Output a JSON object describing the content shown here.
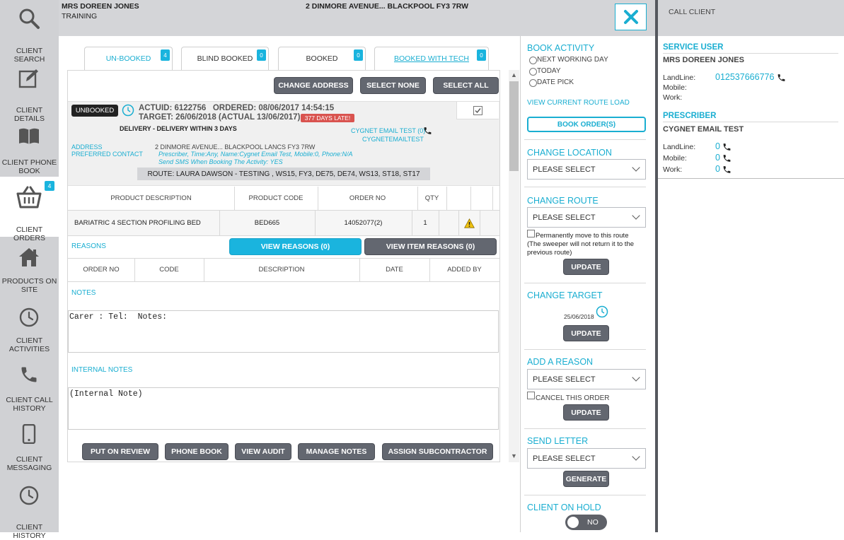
{
  "header": {
    "client_name": "MRS DOREEN JONES",
    "client_sub": "TRAINING",
    "address": "2 DINMORE AVENUE... BLACKPOOL FY3 7RW",
    "call_client": "CALL CLIENT"
  },
  "sidebar": {
    "items": [
      {
        "label": "CLIENT SEARCH"
      },
      {
        "label": "CLIENT DETAILS"
      },
      {
        "label": "CLIENT PHONE BOOK"
      },
      {
        "label": "CLIENT ORDERS",
        "badge": "4"
      },
      {
        "label": "PRODUCTS ON SITE"
      },
      {
        "label": "CLIENT ACTIVITIES"
      },
      {
        "label": "CLIENT CALL HISTORY"
      },
      {
        "label": "CLIENT MESSAGING"
      },
      {
        "label": "CLIENT HISTORY"
      }
    ]
  },
  "tabs": [
    {
      "label": "UN-BOOKED",
      "count": "4"
    },
    {
      "label": "BLIND BOOKED",
      "count": "0"
    },
    {
      "label": "BOOKED",
      "count": "0"
    },
    {
      "label": "BOOKED WITH TECH",
      "count": "0"
    }
  ],
  "toolbar": {
    "change_address": "CHANGE ADDRESS",
    "select_none": "SELECT NONE",
    "select_all": "SELECT ALL"
  },
  "order": {
    "status": "UNBOOKED",
    "actuid_line": "ACTUID: 6122756   ORDERED: 08/06/2017 14:54:15",
    "target_line": "TARGET: 26/06/2018 (ACTUAL 13/06/2017)",
    "late_badge": "377 DAYS LATE!",
    "delivery": "DELIVERY - DELIVERY WITHIN 3 DAYS",
    "prescriber_contact": "CYGNET EMAIL TEST (0)",
    "prescriber_email": "CYGNETEMAILTEST",
    "address_label": "ADDRESS",
    "preferred_contact_label": "PREFERRED CONTACT",
    "address_value": "2 DINMORE AVENUE... BLACKPOOL LANCS FY3 7RW",
    "preferred_contact_value": "Prescriber, Time:Any, Name:Cygnet Email Test, Mobile:0, Phone:N/A",
    "sms_note": "Send SMS When Booking The Activity: YES",
    "route": "ROUTE: LAURA DAWSON - TESTING , WS15, FY3, DE75, DE74, WS13, ST18, ST17"
  },
  "product_table": {
    "headers": [
      "PRODUCT DESCRIPTION",
      "PRODUCT CODE",
      "ORDER NO",
      "QTY"
    ],
    "rows": [
      {
        "description": "BARIATRIC 4 SECTION PROFILING BED",
        "code": "BED665",
        "order_no": "14052077(2)",
        "qty": "1"
      }
    ]
  },
  "reasons": {
    "label": "REASONS",
    "view_reasons": "VIEW REASONS (0)",
    "view_item_reasons": "VIEW ITEM REASONS (0)",
    "headers": [
      "ORDER NO",
      "CODE",
      "DESCRIPTION",
      "DATE",
      "ADDED BY"
    ]
  },
  "notes": {
    "label": "NOTES",
    "value": "Carer : Tel:  Notes:",
    "internal_label": "INTERNAL NOTES",
    "internal_value": "(Internal Note)"
  },
  "footer_buttons": {
    "put_on_review": "PUT ON REVIEW",
    "phone_book": "PHONE BOOK",
    "view_audit": "VIEW AUDIT",
    "manage_notes": "MANAGE NOTES",
    "assign_subcontractor": "ASSIGN SUBCONTRACTOR"
  },
  "right_panel": {
    "book_activity": "BOOK ACTIVITY",
    "opt_next": "NEXT WORKING DAY",
    "opt_today": "TODAY",
    "opt_date": "DATE PICK",
    "view_route_load": "VIEW CURRENT ROUTE LOAD",
    "book_orders": "BOOK ORDER(S)",
    "change_location": "CHANGE LOCATION",
    "please_select": "PLEASE SELECT",
    "change_route": "CHANGE ROUTE",
    "perm_move": "Permanently move to this route",
    "perm_note": "(The sweeper will not return it to the previous route)",
    "update": "UPDATE",
    "change_target": "CHANGE TARGET",
    "target_date": "25/06/2018",
    "add_reason": "ADD A REASON",
    "cancel_order": "CANCEL THIS ORDER",
    "send_letter": "SEND LETTER",
    "generate": "GENERATE",
    "client_on_hold": "CLIENT ON HOLD",
    "hold_value": "NO"
  },
  "contact_panel": {
    "service_user_title": "SERVICE USER",
    "service_user_name": "MRS DOREEN JONES",
    "landline_label": "LandLine:",
    "mobile_label": "Mobile:",
    "work_label": "Work:",
    "service_landline": "012537666776",
    "prescriber_title": "PRESCRIBER",
    "prescriber_name": "CYGNET EMAIL TEST",
    "prescriber_landline": "0",
    "prescriber_mobile": "0",
    "prescriber_work": "0"
  },
  "colors": {
    "accent": "#1aaed1",
    "button": "#636770",
    "late": "#d9534f",
    "header_bg": "#d4d5d8",
    "sidebar_bg": "#d0d1d4"
  }
}
